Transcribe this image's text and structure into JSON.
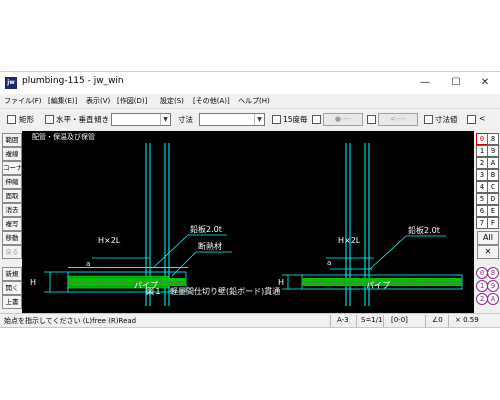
{
  "window": {
    "title": "plumbing-115 - jw_win",
    "icon_label": "jw",
    "controls": {
      "minimize": "—",
      "maximize": "☐",
      "close": "✕"
    }
  },
  "menu": [
    "ファイル(F)",
    "[編集(E)]",
    "表示(V)",
    "[作図(D)]",
    "設定(S)",
    "[その他(A)]",
    "ヘルプ(H)"
  ],
  "toolbar": {
    "rect_label": "矩形",
    "hv_label": "水平・垂直",
    "slope_label": "傾き",
    "dim_label": "寸法",
    "angle15_label": "15度毎",
    "btn1": "●----",
    "btn2": "<----",
    "dimval_label": "寸法値",
    "last_label": "<"
  },
  "left_tools": [
    "範囲",
    "複線",
    "コーナー",
    "伸縮",
    "面取",
    "消去",
    "複写",
    "移動",
    "戻る",
    "新規",
    "開く",
    "上書"
  ],
  "right_tools": {
    "layer_rows": [
      [
        "0",
        "8"
      ],
      [
        "1",
        "9"
      ],
      [
        "2",
        "A"
      ],
      [
        "3",
        "B"
      ],
      [
        "4",
        "C"
      ],
      [
        "5",
        "D"
      ],
      [
        "6",
        "E"
      ],
      [
        "7",
        "F"
      ]
    ],
    "all_label": "All",
    "x_label": "✕",
    "group_rows": [
      [
        "0",
        "8"
      ],
      [
        "1",
        "9"
      ],
      [
        "2",
        "A"
      ]
    ]
  },
  "drawing": {
    "top_text": "配管・保温及び保管",
    "left": {
      "hx2l": "H×2L",
      "lead": "鉛板2.0t",
      "insul": "断熱材",
      "a": "a",
      "h": "H",
      "pipe": "パイプ"
    },
    "right": {
      "hx2l": "H×2L",
      "lead": "鉛板2.0t",
      "a": "a",
      "h": "H",
      "pipe": "パイプ"
    },
    "caption": "図１　軽量間仕切り壁(鉛ボード)貫通"
  },
  "status": {
    "message": "始点を指示してください (L)free (R)Read",
    "paper": "A-3",
    "scale": "S=1/1",
    "layer": "[0-0]",
    "angle": "∠0",
    "zoom": "× 0.59"
  },
  "colors": {
    "canvas_bg": "#000000",
    "drawing_line": "#00ffff",
    "drawing_text": "#ffffff",
    "pipe_fill": "#00c000",
    "pipe_line": "#ff00ff",
    "layer_active": "#cc0000"
  }
}
